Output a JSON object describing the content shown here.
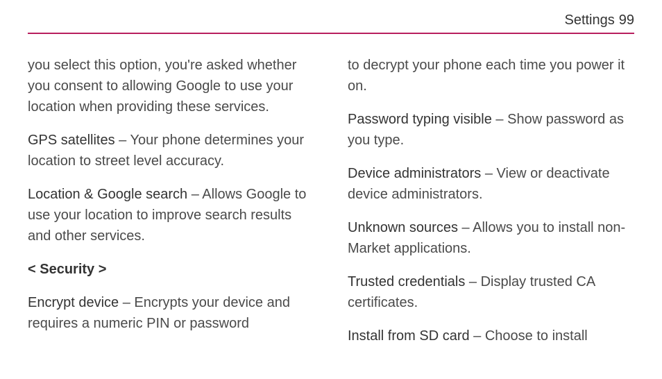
{
  "header": {
    "section": "Settings",
    "page_number": "99"
  },
  "left_column": {
    "p1": {
      "text": "you select this option, you're asked whether you consent to allowing Google to use your location when providing these services."
    },
    "p2": {
      "term": "GPS satellites",
      "desc": " – Your phone determines your location to street level accuracy."
    },
    "p3": {
      "term": "Location & Google search",
      "desc": " – Allows Google to use your location to improve search results and other services."
    },
    "heading": "< Security >",
    "p4": {
      "term": "Encrypt device",
      "desc": " – Encrypts your device and requires a numeric PIN or password"
    }
  },
  "right_column": {
    "p1": {
      "text": "to decrypt your phone each time you power it on."
    },
    "p2": {
      "term": "Password typing visible",
      "desc": " – Show password as you type."
    },
    "p3": {
      "term": "Device administrators",
      "desc": " – View or deactivate device administrators."
    },
    "p4": {
      "term": "Unknown sources",
      "desc": " – Allows you to install non-Market applications."
    },
    "p5": {
      "term": "Trusted credentials",
      "desc": " – Display trusted CA certificates."
    },
    "p6": {
      "term": "Install from SD card",
      "desc": " – Choose to install"
    }
  }
}
